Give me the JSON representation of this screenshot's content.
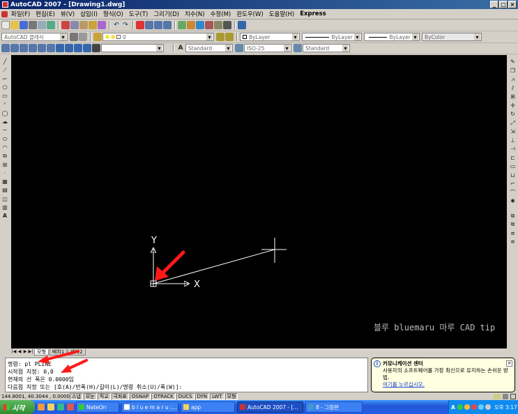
{
  "window": {
    "title": "AutoCAD 2007 - [Drawing1.dwg]",
    "controls": [
      "_",
      "□",
      "×"
    ]
  },
  "menu": [
    "파일(F)",
    "편집(E)",
    "뷰(V)",
    "삽입(I)",
    "형식(O)",
    "도구(T)",
    "그리기(D)",
    "치수(N)",
    "수정(M)",
    "윈도우(W)",
    "도움말(H)",
    "Express"
  ],
  "toolbar2": {
    "workspace": "AutoCAD 클래식",
    "layer": "0",
    "color": "ByLayer",
    "linetype": "ByLayer",
    "lineweight": "ByLayer",
    "plotstyle": "ByColor"
  },
  "toolbar3": {
    "text_style": "Standard",
    "dim_style": "ISO-25",
    "table_style": "Standard"
  },
  "drawing": {
    "ucs_y": "Y",
    "ucs_x": "X",
    "watermark": "블루 bluemaru 마루 CAD tip"
  },
  "tabs": {
    "nav": [
      "|◀",
      "◀",
      "▶",
      "▶|"
    ],
    "items": [
      "모형",
      "배치1",
      "배치2"
    ]
  },
  "command_lines": [
    "명령: pl PLINE",
    "시작점 지정: 0,0",
    "현재의 선 폭은 0.0000임",
    "다음점 지정 또는 [호(A)/반폭(H)/길이(L)/명령 취소(U)/폭(W)]:"
  ],
  "balloon": {
    "title": "커뮤니케이션 센터",
    "body": "사용자의 소프트웨어를 가장 최신으로 유지하는 손쉬운 방법.",
    "link": "여기를 누르십시오."
  },
  "status": {
    "coords": "144.8001, 40.3044 , 0.0000",
    "buttons": [
      "스냅",
      "모눈",
      "직교",
      "극좌표",
      "OSNAP",
      "OTRACK",
      "DUCS",
      "DYN",
      "LWT",
      "모형"
    ]
  },
  "taskbar": {
    "start": "시작",
    "tasks": [
      "NateOn",
      "b l u e m a r u :...",
      "app",
      "AutoCAD 2007 - [...",
      "8 - 그림판"
    ],
    "lang": "A",
    "clock": "오후 3:17"
  },
  "colors": {
    "canvas": "#000000",
    "title_bar": "#0a246a",
    "arrow": "#ff1a1a",
    "taskbar": "#245ce6"
  }
}
